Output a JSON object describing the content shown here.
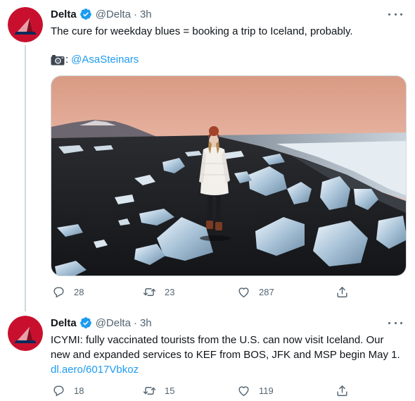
{
  "colors": {
    "accent": "#1d9bf0",
    "text": "#0f1419",
    "muted": "#536471",
    "brand_red": "#c8102e",
    "brand_navy": "#0b2a5b"
  },
  "tweets": [
    {
      "author": {
        "name": "Delta",
        "handle": "@Delta",
        "verified": true,
        "avatar_icon": "delta-logo-icon"
      },
      "time": "3h",
      "separator": "·",
      "text": "The cure for weekday blues = booking a trip to Iceland, probably.",
      "credit": {
        "icon": "camera-icon",
        "colon": ":",
        "link": "@AsaSteinars"
      },
      "media": {
        "kind": "photo",
        "subject": "person-on-black-sand-beach-with-ice"
      },
      "stats": {
        "replies": "28",
        "retweets": "23",
        "likes": "287"
      }
    },
    {
      "author": {
        "name": "Delta",
        "handle": "@Delta",
        "verified": true,
        "avatar_icon": "delta-logo-icon"
      },
      "time": "3h",
      "separator": "·",
      "text": "ICYMI: fully vaccinated tourists from the U.S. can now visit Iceland. Our new and expanded services to KEF from BOS, JFK and MSP begin May 1.",
      "link": "dl.aero/6017Vbkoz",
      "stats": {
        "replies": "18",
        "retweets": "15",
        "likes": "119"
      }
    }
  ]
}
